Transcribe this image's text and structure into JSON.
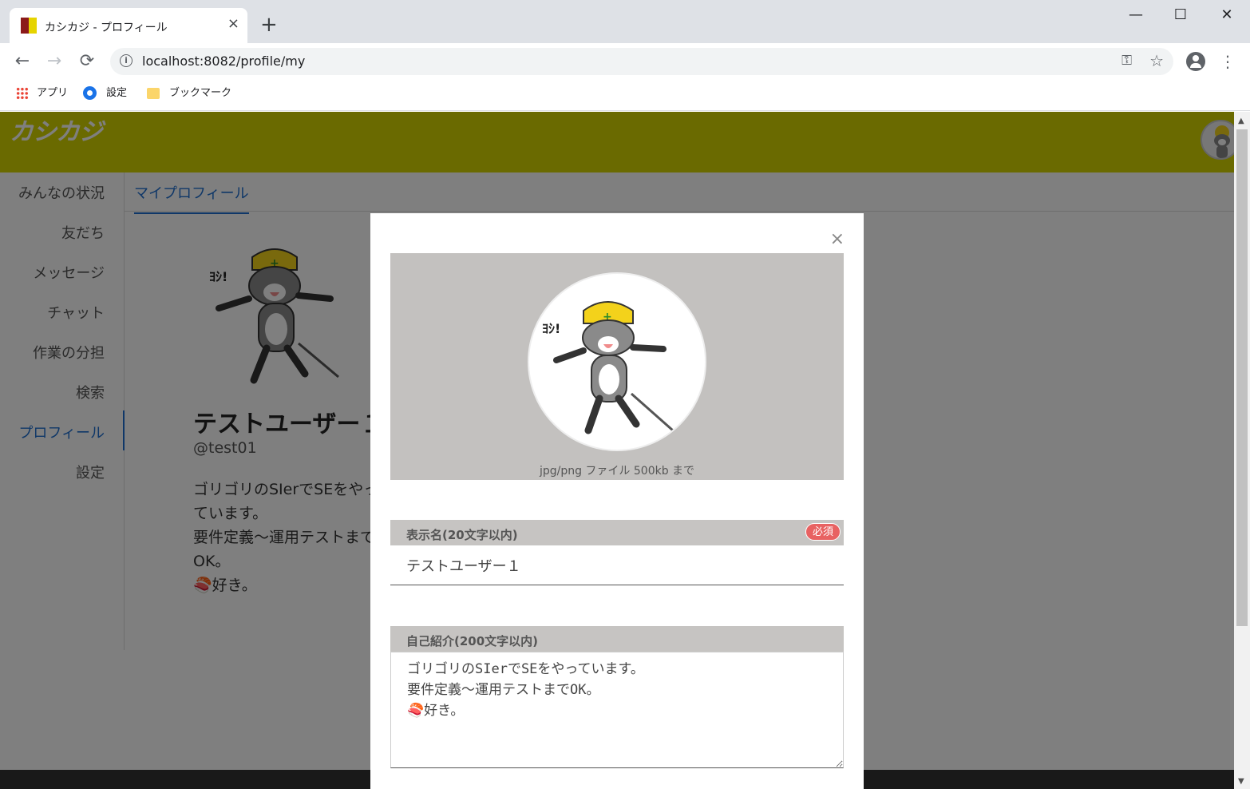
{
  "browser": {
    "tab_title": "カシカジ - プロフィール",
    "tab_close": "×",
    "new_tab": "+",
    "url": "localhost:8082/profile/my",
    "nav": {
      "back": "←",
      "forward": "→",
      "reload": "⟳"
    },
    "window": {
      "minimize": "—",
      "maximize": "☐",
      "close": "✕"
    },
    "bookmarks": [
      {
        "label": "アプリ",
        "icon": "apps-grid-icon"
      },
      {
        "label": "設定",
        "icon": "gear-icon"
      },
      {
        "label": "ブックマーク",
        "icon": "folder-icon"
      }
    ]
  },
  "app": {
    "logo": "カシカジ",
    "header_color": "#d4d400",
    "accent_color": "#1e6fd0",
    "sidebar": [
      {
        "label": "みんなの状況"
      },
      {
        "label": "友だち"
      },
      {
        "label": "メッセージ"
      },
      {
        "label": "チャット"
      },
      {
        "label": "作業の分担"
      },
      {
        "label": "検索"
      },
      {
        "label": "プロフィール",
        "active": true
      },
      {
        "label": "設定"
      }
    ],
    "content_tab": "マイプロフィール",
    "profile": {
      "name": "テストユーザー１",
      "handle": "@test01",
      "bio": "ゴリゴリのSIerでSEをやっています。\n要件定義～運用テストまでOK。\n🍣好き。"
    }
  },
  "modal": {
    "close": "×",
    "image_hint": "jpg/png ファイル 500kb まで",
    "display_name_label": "表示名(20文字以内)",
    "required_badge": "必須",
    "display_name_value": "テストユーザー１",
    "bio_label": "自己紹介(200文字以内)",
    "bio_value": "ゴリゴリのSIerでSEをやっています。\n要件定義～運用テストまでOK。\n🍣好き。"
  }
}
